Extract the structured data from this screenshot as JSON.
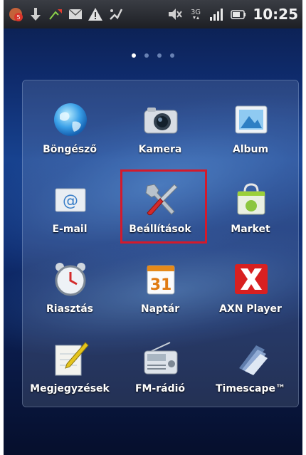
{
  "status_bar": {
    "time": "10:25",
    "network_type": "3G",
    "icons": [
      "xperia-app-notification-icon",
      "download-icon",
      "missed-call-icon",
      "message-icon",
      "warning-icon",
      "usb-debug-icon",
      "mute-icon",
      "3g-icon",
      "signal-icon",
      "battery-icon"
    ]
  },
  "home_pages": {
    "count": 4,
    "active_index": 0
  },
  "apps": [
    {
      "label": "Böngésző",
      "icon": "browser-globe-icon"
    },
    {
      "label": "Kamera",
      "icon": "camera-icon"
    },
    {
      "label": "Album",
      "icon": "album-icon"
    },
    {
      "label": "E-mail",
      "icon": "email-icon"
    },
    {
      "label": "Beállítások",
      "icon": "settings-tools-icon"
    },
    {
      "label": "Market",
      "icon": "market-bag-icon"
    },
    {
      "label": "Riasztás",
      "icon": "alarm-clock-icon"
    },
    {
      "label": "Naptár",
      "icon": "calendar-icon"
    },
    {
      "label": "AXN Player",
      "icon": "axn-player-icon"
    },
    {
      "label": "Megjegyzések",
      "icon": "notes-icon"
    },
    {
      "label": "FM-rádió",
      "icon": "fm-radio-icon"
    },
    {
      "label": "Timescape™",
      "icon": "timescape-icon"
    }
  ],
  "calendar_day": "31",
  "highlighted_app": "Beállítások",
  "colors": {
    "highlight": "#d41a2b",
    "label": "#ffffff"
  }
}
